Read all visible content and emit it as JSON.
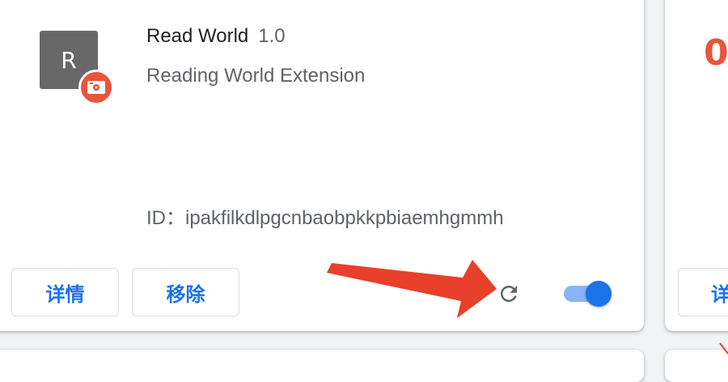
{
  "extension": {
    "icon_letter": "R",
    "name": "Read World",
    "version": "1.0",
    "description": "Reading World Extension",
    "id_text": "ID：ipakfilkdlpgcnbaobpkkpbiaemhgmmh",
    "enabled": true
  },
  "buttons": {
    "details_label": "详情",
    "remove_label": "移除"
  },
  "icons": {
    "reload": "reload-icon",
    "badge": "disk-badge-icon"
  },
  "colors": {
    "accent": "#1a73e8",
    "badge": "#e8553a",
    "annotation_arrow": "#e8402a"
  },
  "right_card": {
    "logo_text": "0",
    "button_label": "详"
  }
}
